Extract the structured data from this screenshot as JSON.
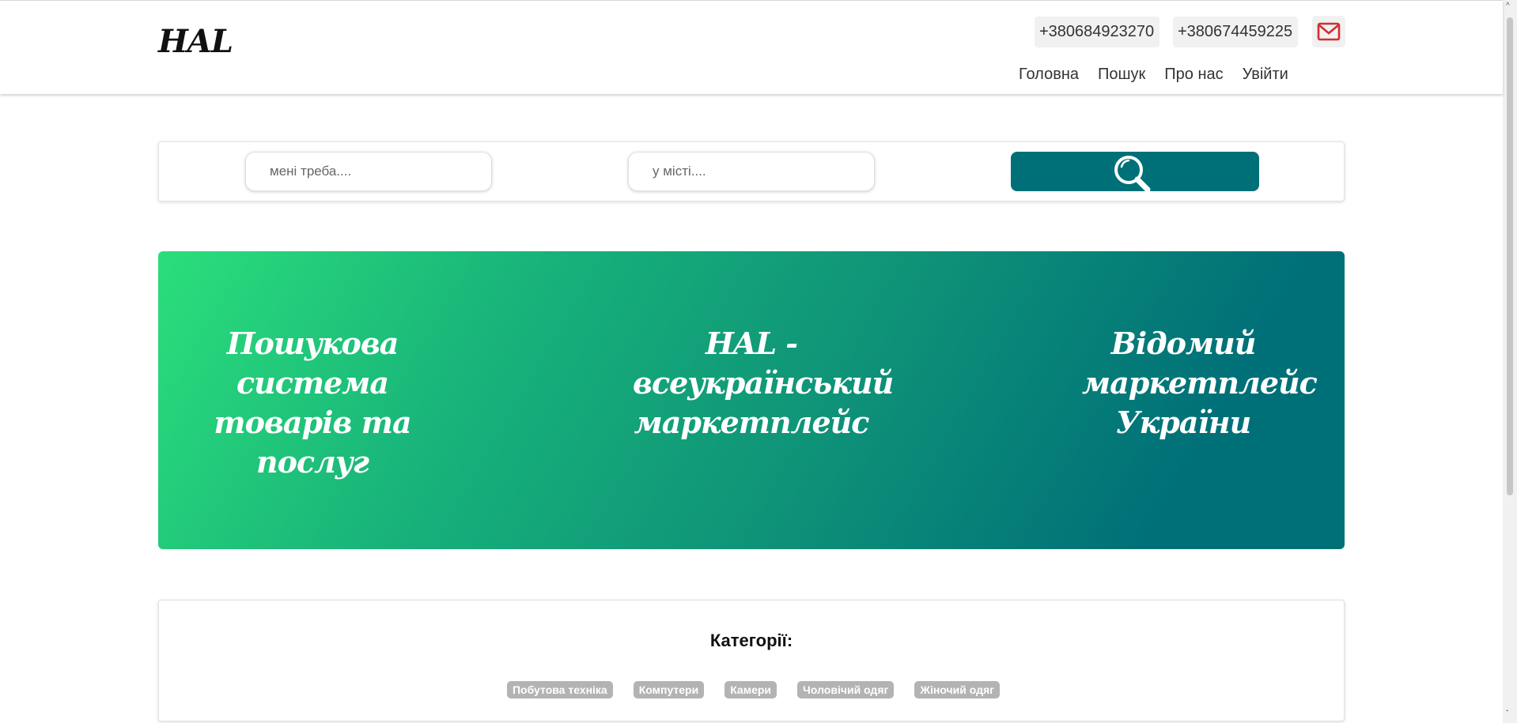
{
  "header": {
    "logo": "HAL",
    "phones": [
      "+380684923270",
      "+380674459225"
    ],
    "mail_icon": "envelope-icon",
    "nav": [
      "Головна",
      "Пошук",
      "Про нас",
      "Увійти"
    ]
  },
  "search": {
    "what_placeholder": "мені треба....",
    "where_placeholder": "у місті....",
    "button_icon": "magnifier-icon"
  },
  "banner": {
    "slogan_left": "Пошукова система товарів та послуг",
    "slogan_center": "HAL - всеукраїнський маркетплейс",
    "slogan_right": "Відомий маркетплейс України"
  },
  "categories": {
    "title": "Категорії:",
    "items": [
      "Побутова техніка",
      "Компутери",
      "Камери",
      "Чоловічий одяг",
      "Жіночий одяг"
    ]
  },
  "colors": {
    "accent": "#007078",
    "gradient_start": "#2bde7b",
    "gradient_end": "#007078",
    "mail_icon": "#d32f2f",
    "tag_bg": "#b3b3b3"
  }
}
